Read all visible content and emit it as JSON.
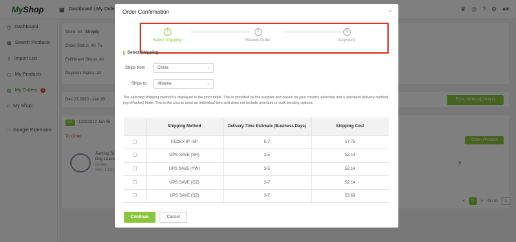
{
  "app": {
    "logo_prefix": "My",
    "logo_suffix": "Shop",
    "breadcrumb": "Dashboard | My Orde"
  },
  "sidebar": {
    "items": [
      {
        "label": "Dashboard",
        "icon": "dashboard-icon"
      },
      {
        "label": "Search Products",
        "icon": "grid-icon"
      },
      {
        "label": "Import List",
        "icon": "import-icon"
      },
      {
        "label": "My Products",
        "icon": "box-icon"
      },
      {
        "label": "My Orders",
        "icon": "orders-icon",
        "badge": "2"
      },
      {
        "label": "My Shop",
        "icon": "shop-icon"
      },
      {
        "label": "Google Extension",
        "icon": "extension-icon"
      }
    ]
  },
  "filters": {
    "store_label": "Store: All",
    "store_value": "Shopify",
    "order_status": "Order Status: All",
    "order_status_extra": "To",
    "fulfillment": "Fulfillment Status: All",
    "payment": "Payment Status: All"
  },
  "date_bar": {
    "range": "Dec 27,2020 - Jan 26",
    "sync_label": "Sync Order(s)(7days)"
  },
  "order": {
    "badge": "US",
    "number": "12321312 Jan 05",
    "to_order": "To Order",
    "order_product_label": "Order Product",
    "product_lines": [
      "Jiaming St",
      "Dog Leash",
      "Green",
      "SKU:1320"
    ],
    "qty": "3"
  },
  "pager": {
    "prev": "<",
    "current": "1",
    "next": ">",
    "goto": "Go to",
    "goto_value": "1"
  },
  "modal": {
    "title": "Order Confirmation",
    "close": "×",
    "steps": [
      {
        "num": "1",
        "label": "Select Shipping",
        "active": true
      },
      {
        "num": "2",
        "label": "Review Order",
        "active": false
      },
      {
        "num": "3",
        "label": "Payment",
        "active": false
      }
    ],
    "section_title": "Select Shipping",
    "ships_from_label": "Ships from",
    "ships_from_value": "China",
    "ships_to_label": "Ships to",
    "ships_to_value": "Albania",
    "description": "The selected shipping method is displayed in the price table. This is provided by the supplier and based on your country selection and a standard delivery method (eg ePacket) Note: This is the cost to send an individual item and does not include premium or bulk sending options.",
    "table": {
      "headers": [
        "",
        "Shipping Method",
        "Delivery Time Estimate (Business Days)",
        "Shipping Cost"
      ],
      "rows": [
        {
          "method": "FEDEX IP -SP",
          "time": "5-7",
          "cost": "17.75"
        },
        {
          "method": "UPS SAVE (SH)",
          "time": "3-5",
          "cost": "52.14"
        },
        {
          "method": "UPS SAVE (YW)",
          "time": "3-5",
          "cost": "52.14"
        },
        {
          "method": "UPS SAVE (GZ)",
          "time": "3-7",
          "cost": "52.14"
        },
        {
          "method": "UPS SAVE (SZ)",
          "time": "3-7",
          "cost": "53.63"
        }
      ]
    },
    "continue_label": "Continue",
    "cancel_label": "Cancel"
  },
  "colors": {
    "accent": "#8cc63f",
    "highlight_border": "#d9332a",
    "danger": "#e03a3a"
  }
}
